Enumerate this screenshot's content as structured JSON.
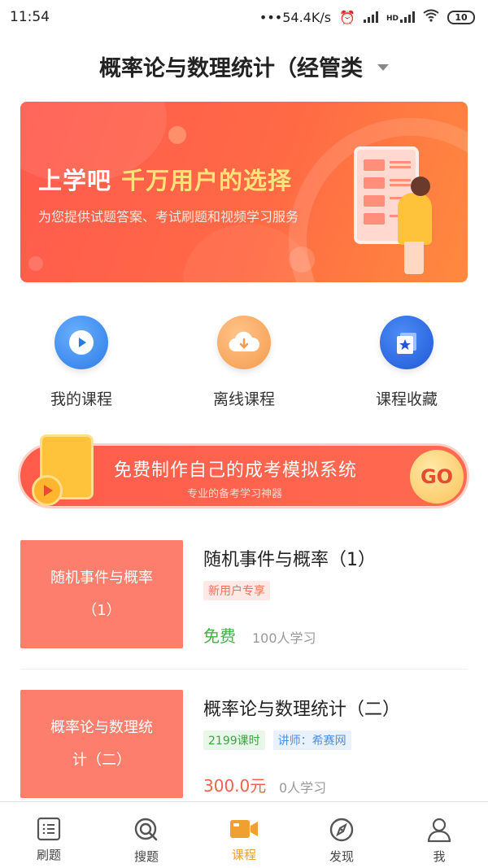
{
  "status_bar": {
    "time": "11:54",
    "speed": "54.4K/s",
    "network": "HD",
    "battery": "10"
  },
  "header": {
    "title": "概率论与数理统计（经管类"
  },
  "banner": {
    "headline": "上学吧",
    "highlight": "千万用户的选择",
    "subtitle": "为您提供试题答案、考试刷题和视频学习服务"
  },
  "actions": [
    {
      "label": "我的课程",
      "icon": "play-icon",
      "color": "#3d8ef0"
    },
    {
      "label": "离线课程",
      "icon": "cloud-download-icon",
      "color": "#f7a35c"
    },
    {
      "label": "课程收藏",
      "icon": "star-bookmark-icon",
      "color": "#2f6fe0"
    }
  ],
  "promo": {
    "title": "免费制作自己的成考模拟系统",
    "subtitle": "专业的备考学习神器",
    "go_label": "GO"
  },
  "courses": [
    {
      "thumb": "随机事件与概率（1）",
      "title": "随机事件与概率（1）",
      "tag": "新用户专享",
      "price": "免费",
      "learners": "100人学习"
    },
    {
      "thumb": "概率论与数理统计（二）",
      "title": "概率论与数理统计（二）",
      "hours": "2199课时",
      "teacher": "讲师：希赛网",
      "price": "300.0元",
      "learners": "0人学习"
    }
  ],
  "tabbar": {
    "active": "课程",
    "items": [
      {
        "label": "刷题",
        "icon": "list-icon"
      },
      {
        "label": "搜题",
        "icon": "search-icon"
      },
      {
        "label": "课程",
        "icon": "video-camera-icon"
      },
      {
        "label": "发现",
        "icon": "compass-icon"
      },
      {
        "label": "我",
        "icon": "person-icon"
      }
    ]
  },
  "colors": {
    "accent": "#f0a030",
    "price_free": "#43b049",
    "price_paid": "#f0624a",
    "thumb": "#fd7e6c"
  }
}
